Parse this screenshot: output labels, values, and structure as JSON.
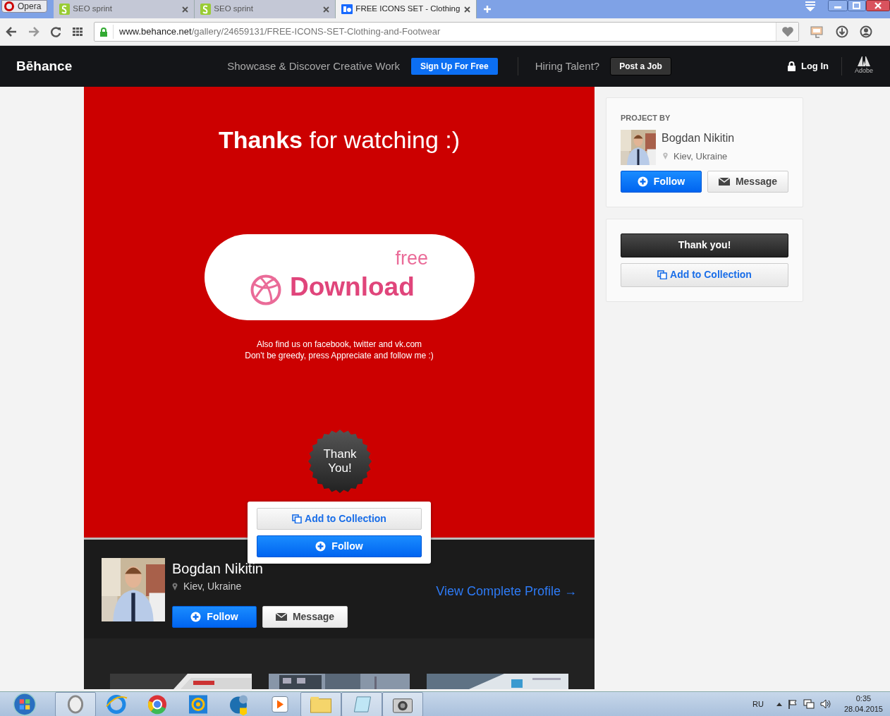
{
  "browser": {
    "menu_label": "Opera",
    "tabs": [
      {
        "title": "SEO sprint",
        "selected": false
      },
      {
        "title": "SEO sprint",
        "selected": false
      },
      {
        "title": "FREE ICONS SET - Clothing",
        "selected": true
      }
    ],
    "url_host": "www.behance.net",
    "url_path": "/gallery/24659131/FREE-ICONS-SET-Clothing-and-Footwear"
  },
  "site_nav": {
    "logo": "Bēhance",
    "tagline": "Showcase & Discover Creative Work",
    "signup": "Sign Up For Free",
    "hiring": "Hiring Talent?",
    "post_job": "Post a Job",
    "login": "Log In",
    "adobe": "Adobe"
  },
  "project": {
    "heading": "**Thanks** for watching :)",
    "download_small": "free",
    "download": "Download",
    "lines": [
      "Also find us on facebook, twitter and vk.com",
      "Don't be greedy, press Appreciate and follow me :)"
    ],
    "badge": "Thank You!"
  },
  "popup": {
    "add": "Add to Collection",
    "follow": "Follow"
  },
  "owner": {
    "name": "Bogdan Nikitin",
    "location": "Kiev, Ukraine",
    "follow": "Follow",
    "message": "Message",
    "profile_link": "View Complete Profile →"
  },
  "sidebar": {
    "label": "PROJECT BY",
    "name": "Bogdan Nikitin",
    "location": "Kiev, Ukraine",
    "follow": "Follow",
    "message": "Message",
    "thank": "Thank you!",
    "add": "Add to Collection"
  },
  "taskbar": {
    "language": "RU",
    "time": "0:35",
    "date": "28.04.2015"
  }
}
